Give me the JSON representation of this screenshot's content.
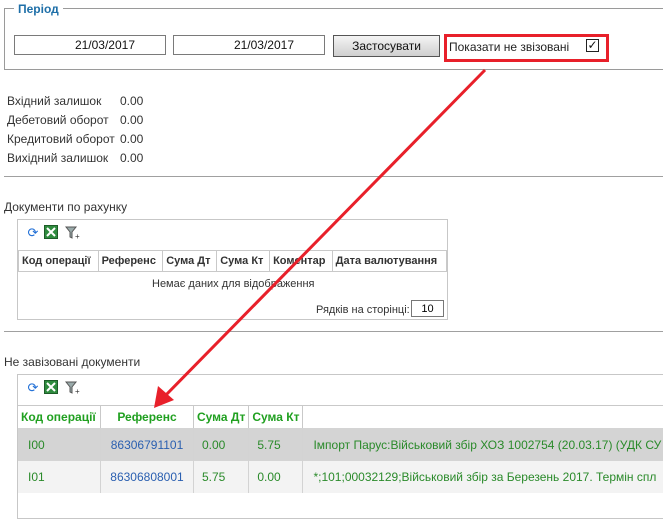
{
  "period": {
    "legend": "Період",
    "date_from": "21/03/2017",
    "date_to": "21/03/2017",
    "apply_label": "Застосувати",
    "show_unassigned_label": "Показати не звізовані",
    "show_unassigned_checked": "✓"
  },
  "balances": [
    {
      "label": "Вхідний залишок",
      "value": "0.00"
    },
    {
      "label": "Дебетовий оборот",
      "value": "0.00"
    },
    {
      "label": "Кредитовий оборот",
      "value": "0.00"
    },
    {
      "label": "Вихідний залишок",
      "value": "0.00"
    }
  ],
  "account_docs": {
    "title": "Документи по рахунку",
    "columns": [
      "Код операції",
      "Референс",
      "Сума Дт",
      "Сума Кт",
      "Коментар",
      "Дата валютування"
    ],
    "empty_message": "Немає даних для відображення",
    "rows_per_page_label": "Рядків на сторінці:",
    "rows_per_page_value": "10"
  },
  "unassigned_docs": {
    "title": "Не завізовані документи",
    "columns": [
      "Код операції",
      "Референс",
      "Сума Дт",
      "Сума Кт"
    ],
    "rows": [
      {
        "code": "I00",
        "reference": "86306791101",
        "debit": "0.00",
        "credit": "5.75",
        "comment": "Імпорт Парус:Військовий збір ХОЗ 1002754 (20.03.17) (УДК СУ"
      },
      {
        "code": "I01",
        "reference": "86306808001",
        "debit": "5.75",
        "credit": "0.00",
        "comment": "*;101;00032129;Військовий збір за Березень 2017. Термін спл"
      }
    ]
  },
  "icons": [
    "refresh-icon",
    "excel-export-icon",
    "filter-icon"
  ],
  "colors": {
    "highlight": "#e8202a",
    "header_green": "#20a020",
    "link_blue": "#2a5fb0",
    "legend_blue": "#1e6fa8"
  }
}
